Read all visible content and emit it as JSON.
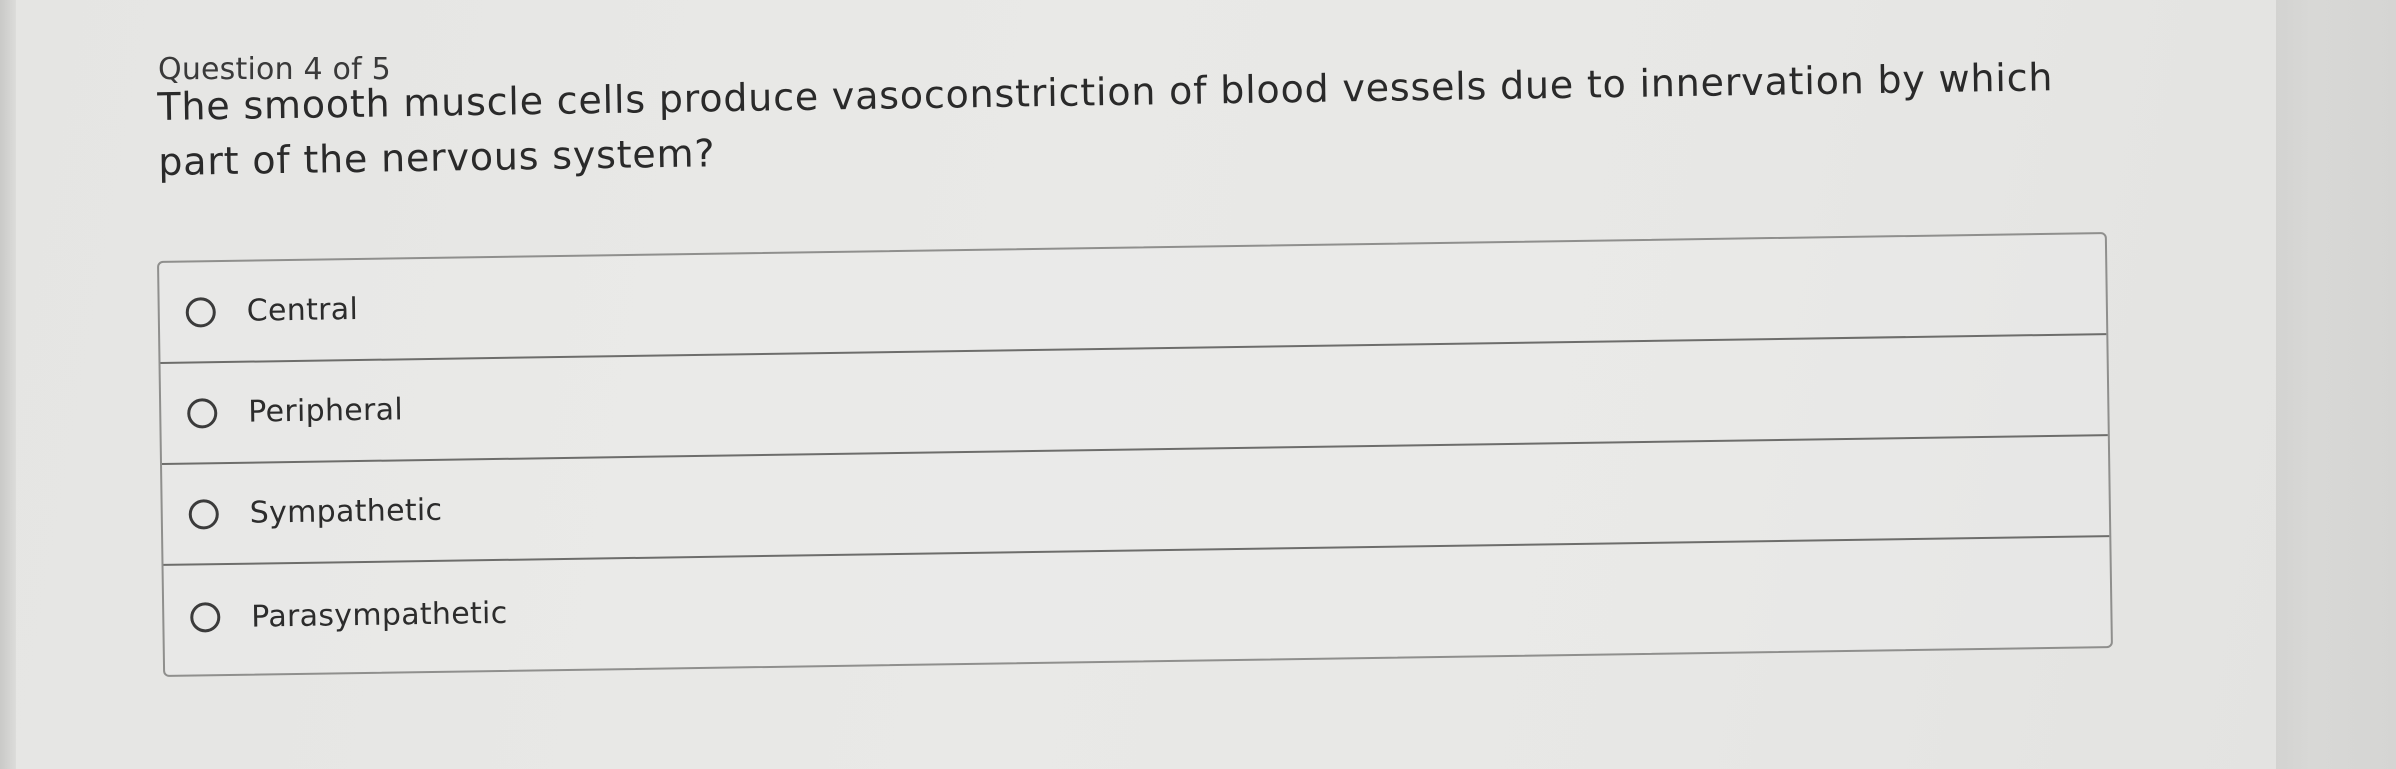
{
  "quiz": {
    "counter": "Question 4 of 5",
    "question": "The smooth muscle cells produce vasoconstriction of blood vessels due to innervation by which part of the nervous system?",
    "options": [
      {
        "label": "Central",
        "selected": false
      },
      {
        "label": "Peripheral",
        "selected": false
      },
      {
        "label": "Sympathetic",
        "selected": false
      },
      {
        "label": "Parasympathetic",
        "selected": false
      }
    ]
  },
  "colors": {
    "page_background": "#e7e7e5",
    "text": "#2b2b2b",
    "border": "#8f8f8d"
  },
  "icons": {
    "option_marker": "radio-unchecked-icon"
  }
}
